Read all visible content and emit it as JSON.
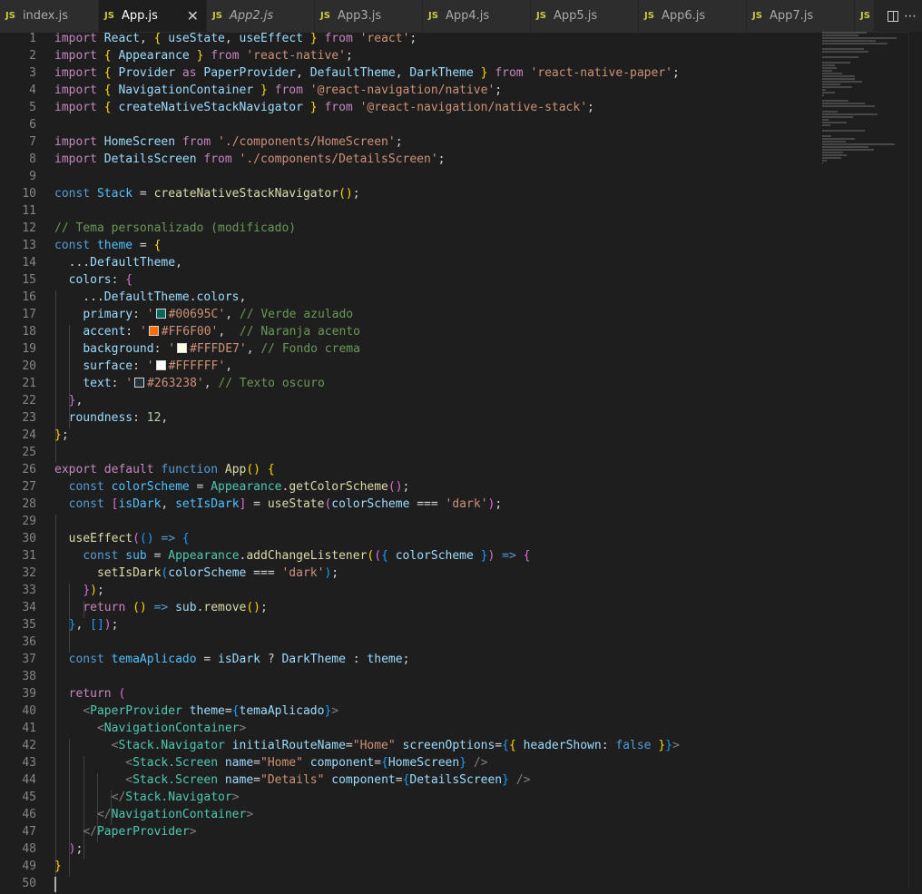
{
  "tabs": [
    {
      "label": "index.js",
      "icon": "JS",
      "active": false
    },
    {
      "label": "App.js",
      "icon": "JS",
      "active": true,
      "close": "✕"
    },
    {
      "label": "App2.js",
      "icon": "JS",
      "active": false,
      "italic": true
    },
    {
      "label": "App3.js",
      "icon": "JS",
      "active": false
    },
    {
      "label": "App4.js",
      "icon": "JS",
      "active": false
    },
    {
      "label": "App5.js",
      "icon": "JS",
      "active": false
    },
    {
      "label": "App6.js",
      "icon": "JS",
      "active": false
    },
    {
      "label": "App7.js",
      "icon": "JS",
      "active": false
    }
  ],
  "overflow_tab": {
    "icon": "JS"
  },
  "colors": {
    "swatch_primary": "#00695C",
    "swatch_accent": "#FF6F00",
    "swatch_background": "#FFFDE7",
    "swatch_surface": "#FFFFFF",
    "swatch_text": "#263238"
  },
  "code": {
    "l1": "import React, { useState, useEffect } from 'react';",
    "l2": "import { Appearance } from 'react-native';",
    "l3": "import { Provider as PaperProvider, DefaultTheme, DarkTheme } from 'react-native-paper';",
    "l4": "import { NavigationContainer } from '@react-navigation/native';",
    "l5": "import { createNativeStackNavigator } from '@react-navigation/native-stack';",
    "l7": "import HomeScreen from './components/HomeScreen';",
    "l8": "import DetailsScreen from './components/DetailsScreen';",
    "l10": "const Stack = createNativeStackNavigator();",
    "l12": "// Tema personalizado (modificado)",
    "l13": "const theme = {",
    "l14": "  ...DefaultTheme,",
    "l15": "  colors: {",
    "l16": "    ...DefaultTheme.colors,",
    "l17": "    primary: '#00695C', // Verde azulado",
    "l18": "    accent: '#FF6F00',  // Naranja acento",
    "l19": "    background: '#FFFDE7', // Fondo crema",
    "l20": "    surface: '#FFFFFF',",
    "l21": "    text: '#263238', // Texto oscuro",
    "l22": "  },",
    "l23": "  roundness: 12,",
    "l24": "};",
    "l26": "export default function App() {",
    "l27": "  const colorScheme = Appearance.getColorScheme();",
    "l28": "  const [isDark, setIsDark] = useState(colorScheme === 'dark');",
    "l30": "  useEffect(() => {",
    "l31": "    const sub = Appearance.addChangeListener(({ colorScheme }) => {",
    "l32": "      setIsDark(colorScheme === 'dark');",
    "l33": "    });",
    "l34": "    return () => sub.remove();",
    "l35": "  }, []);",
    "l37": "  const temaAplicado = isDark ? DarkTheme : theme;",
    "l39": "  return (",
    "l40": "    <PaperProvider theme={temaAplicado}>",
    "l41": "      <NavigationContainer>",
    "l42": "        <Stack.Navigator initialRouteName=\"Home\" screenOptions={{ headerShown: false }}>",
    "l43": "          <Stack.Screen name=\"Home\" component={HomeScreen} />",
    "l44": "          <Stack.Screen name=\"Details\" component={DetailsScreen} />",
    "l45": "        </Stack.Navigator>",
    "l46": "      </NavigationContainer>",
    "l47": "    </PaperProvider>",
    "l48": "  );",
    "l49": "}"
  },
  "line_numbers": [
    "1",
    "2",
    "3",
    "4",
    "5",
    "6",
    "7",
    "8",
    "9",
    "10",
    "11",
    "12",
    "13",
    "14",
    "15",
    "16",
    "17",
    "18",
    "19",
    "20",
    "21",
    "22",
    "23",
    "24",
    "25",
    "26",
    "27",
    "28",
    "29",
    "30",
    "31",
    "32",
    "33",
    "34",
    "35",
    "36",
    "37",
    "38",
    "39",
    "40",
    "41",
    "42",
    "43",
    "44",
    "45",
    "46",
    "47",
    "48",
    "49",
    "50"
  ]
}
